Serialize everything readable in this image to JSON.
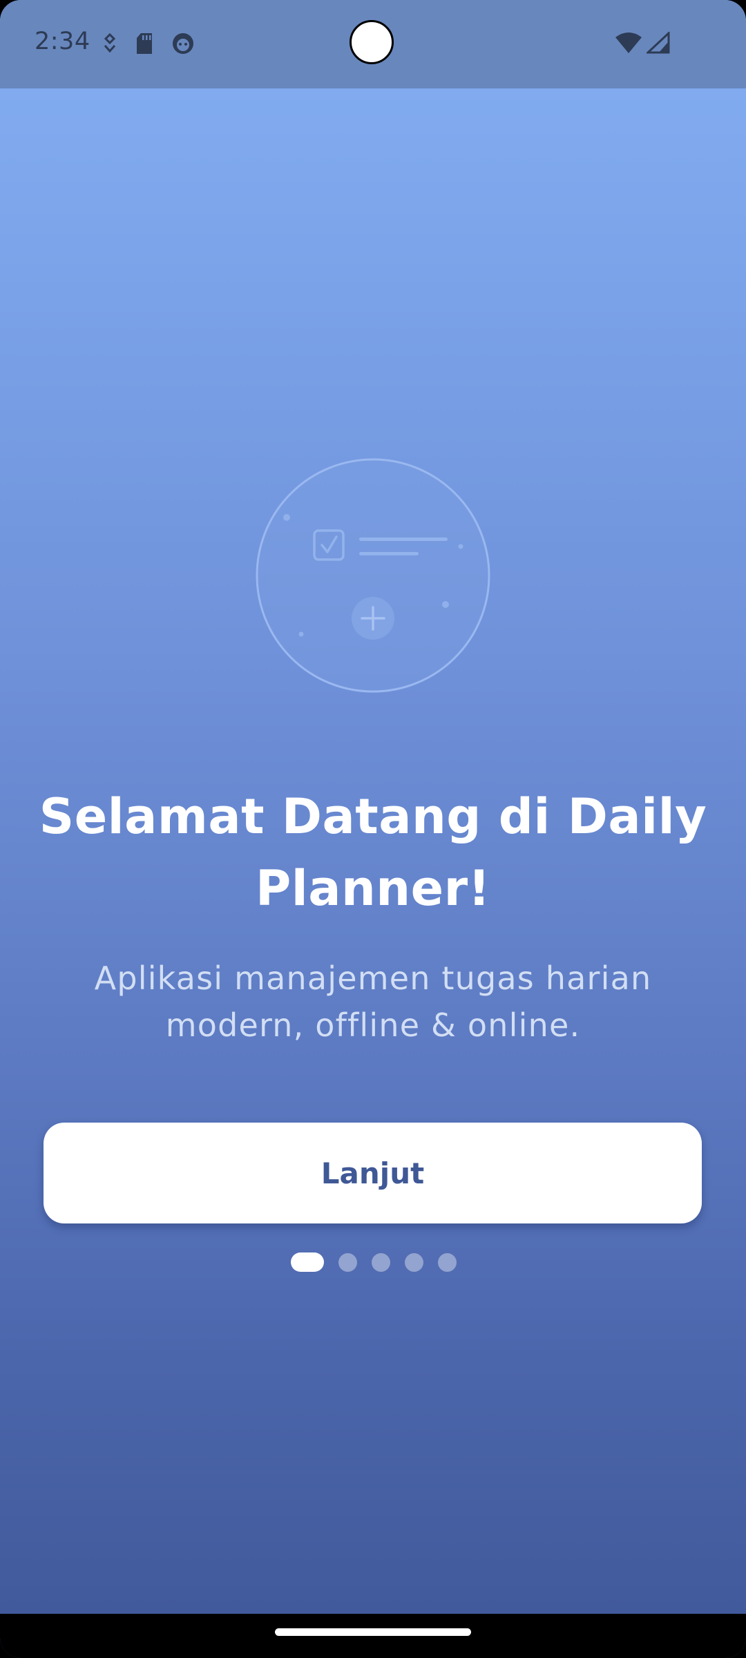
{
  "status_bar": {
    "time": "2:34",
    "left_icons": [
      "location-drop-icon",
      "sd-card-icon",
      "face-icon"
    ],
    "right_icons": [
      "wifi-icon",
      "signal-icon"
    ]
  },
  "illustration": {
    "icons": [
      "checklist-icon",
      "plus-icon"
    ]
  },
  "onboarding": {
    "title": "Selamat Datang di Daily Planner!",
    "subtitle": "Aplikasi manajemen tugas harian modern, offline & online.",
    "next_label": "Lanjut",
    "page_count": 5,
    "active_page": 1
  },
  "colors": {
    "gradient_top": "#84aef2",
    "gradient_bottom": "#3f5898",
    "button_text": "#3f5896",
    "status_bar": "#6887bd"
  }
}
